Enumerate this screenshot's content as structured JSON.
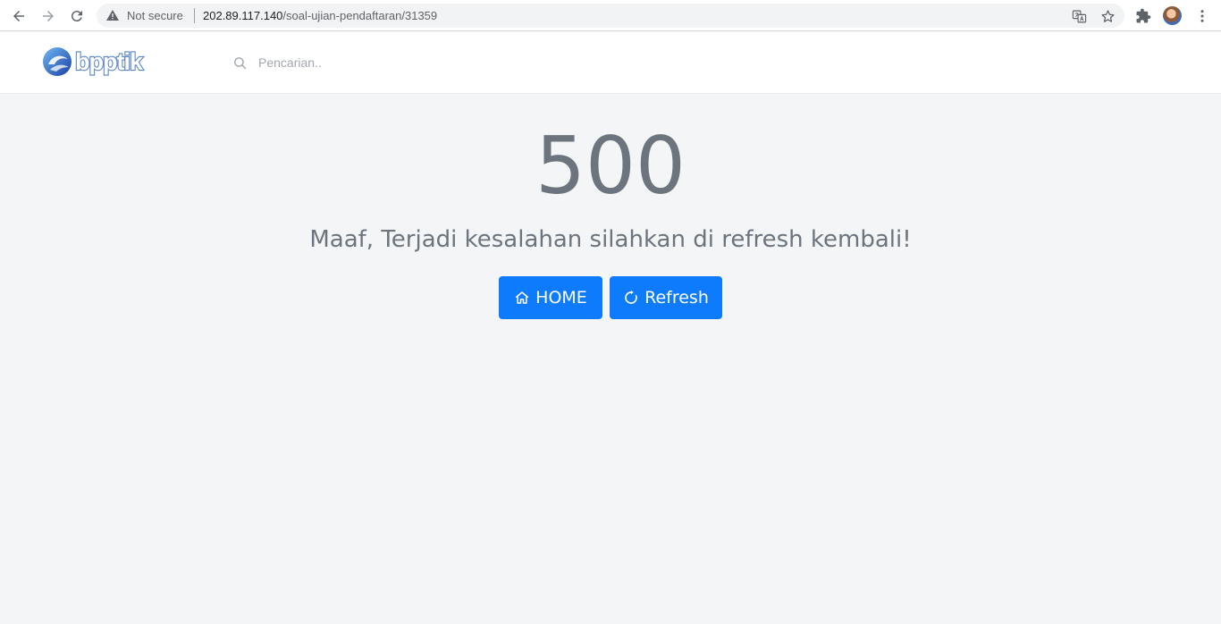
{
  "browser": {
    "security_label": "Not secure",
    "url_host": "202.89.117.140",
    "url_path": "/soal-ujian-pendaftaran/31359"
  },
  "header": {
    "logo_text": "bpptik",
    "search_placeholder": "Pencarian.."
  },
  "error": {
    "code": "500",
    "message": "Maaf, Terjadi kesalahan silahkan di refresh kembali!"
  },
  "actions": {
    "home_label": "HOME",
    "refresh_label": "Refresh"
  },
  "colors": {
    "button": "#0d7bfc",
    "text_muted": "#6c757d",
    "page_bg": "#f4f5f7"
  }
}
